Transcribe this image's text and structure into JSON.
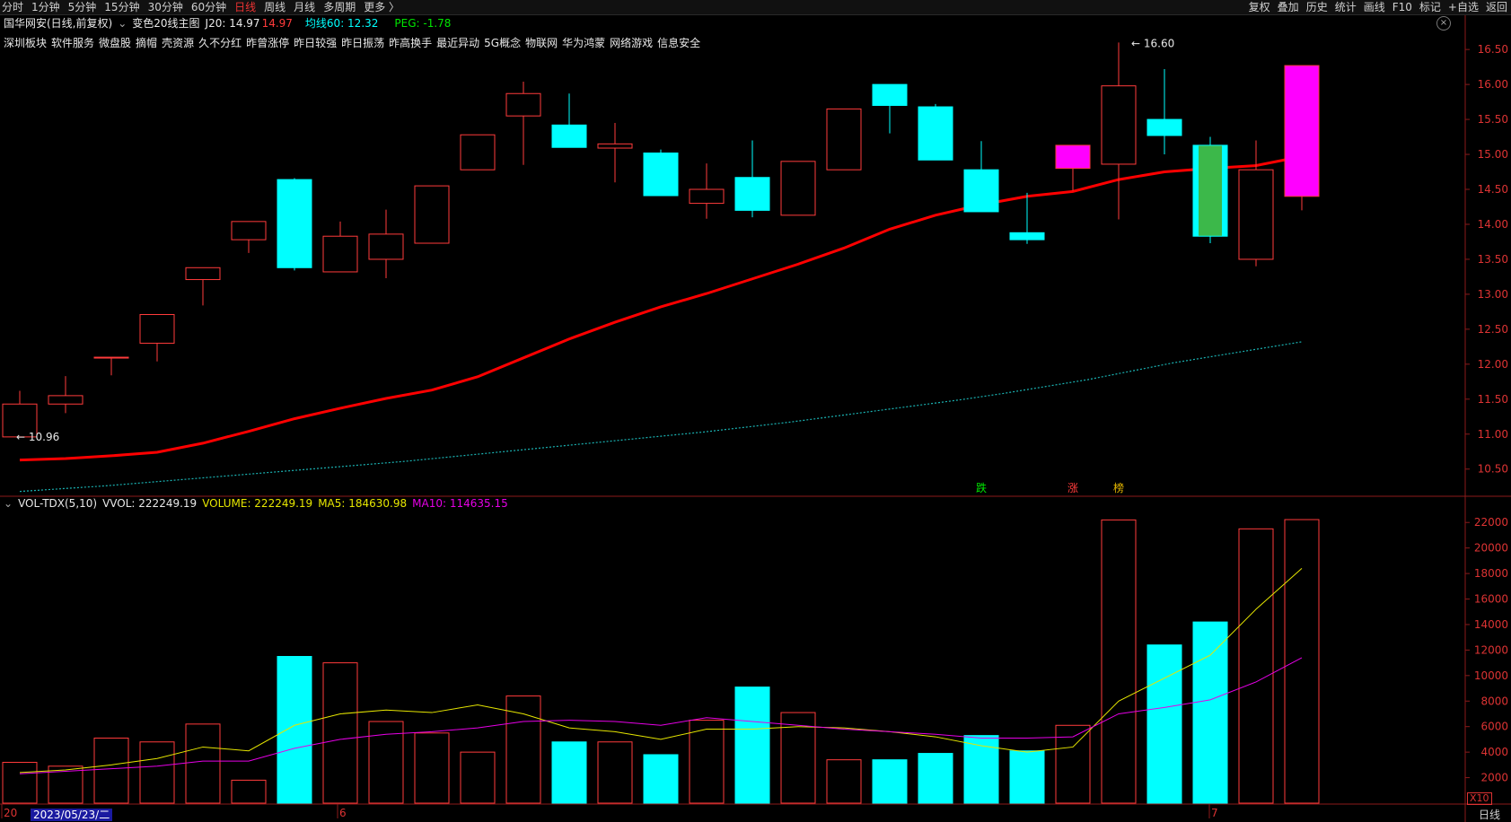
{
  "toolbar": {
    "periods": [
      "分时",
      "1分钟",
      "5分钟",
      "15分钟",
      "30分钟",
      "60分钟",
      "日线",
      "周线",
      "月线",
      "多周期",
      "更多 〉"
    ],
    "active_period": "日线",
    "right_buttons": [
      "复权",
      "叠加",
      "历史",
      "统计",
      "画线",
      "F10",
      "标记",
      "+自选",
      "返回"
    ]
  },
  "info": {
    "stock": "国华网安(日线,前复权)",
    "indicator": "变色20线主图",
    "j20_label": "J20: 14.97",
    "j20_extra": "14.97",
    "ma60_label": "均线60: 12.32",
    "peg_label": "PEG: -1.78"
  },
  "tags": [
    "深圳板块",
    "软件服务",
    "微盘股",
    "摘帽",
    "壳资源",
    "久不分红",
    "昨曾涨停",
    "昨日较强",
    "昨日振荡",
    "昨高换手",
    "最近异动",
    "5G概念",
    "物联网",
    "华为鸿蒙",
    "网络游戏",
    "信息安全"
  ],
  "volume_header": {
    "name": "VOL-TDX(5,10)",
    "vvol": "VVOL: 222249.19",
    "volume": "VOLUME: 222249.19",
    "ma5": "MA5: 184630.98",
    "ma10": "MA10: 114635.15"
  },
  "price_axis": [
    "16.50",
    "16.00",
    "15.50",
    "15.00",
    "14.50",
    "14.00",
    "13.50",
    "13.00",
    "12.50",
    "12.00",
    "11.50",
    "11.00",
    "10.50"
  ],
  "volume_axis": [
    "22000",
    "20000",
    "18000",
    "16000",
    "14000",
    "12000",
    "10000",
    "8000",
    "6000",
    "4000",
    "2000"
  ],
  "volume_unit": "X10",
  "markers": {
    "high": "16.60",
    "low": "10.96",
    "die": "跌",
    "zhang": "涨",
    "bang": "榜"
  },
  "x_labels": {
    "first": "20",
    "date": "2023/05/23/二",
    "june": "6",
    "july": "7"
  },
  "bottom_tab": "日线",
  "colors": {
    "up": "#ff3b3b",
    "down": "#00ffff",
    "ma_red": "#ff0000",
    "ma60": "#1ab2b2",
    "ma5": "#e6e600",
    "ma10": "#e600e6",
    "magenta": "#ff00ff",
    "green": "#3cb84a"
  },
  "chart_data": {
    "type": "candlestick",
    "candles": [
      {
        "o": 10.96,
        "h": 11.62,
        "l": 10.96,
        "c": 11.43,
        "color": "up"
      },
      {
        "o": 11.43,
        "h": 11.83,
        "l": 11.3,
        "c": 11.55,
        "color": "up"
      },
      {
        "o": 12.1,
        "h": 12.1,
        "l": 11.84,
        "c": 12.1,
        "color": "up"
      },
      {
        "o": 12.3,
        "h": 12.71,
        "l": 12.04,
        "c": 12.71,
        "color": "up"
      },
      {
        "o": 13.21,
        "h": 13.38,
        "l": 12.84,
        "c": 13.38,
        "color": "up"
      },
      {
        "o": 13.78,
        "h": 14.04,
        "l": 13.59,
        "c": 14.04,
        "color": "up"
      },
      {
        "o": 14.64,
        "h": 14.66,
        "l": 13.34,
        "c": 13.38,
        "color": "down"
      },
      {
        "o": 13.32,
        "h": 14.04,
        "l": 13.32,
        "c": 13.83,
        "color": "up"
      },
      {
        "o": 13.5,
        "h": 14.21,
        "l": 13.23,
        "c": 13.86,
        "color": "up"
      },
      {
        "o": 13.73,
        "h": 14.55,
        "l": 13.73,
        "c": 14.55,
        "color": "up"
      },
      {
        "o": 14.78,
        "h": 15.28,
        "l": 14.78,
        "c": 15.28,
        "color": "up"
      },
      {
        "o": 15.55,
        "h": 16.04,
        "l": 14.85,
        "c": 15.87,
        "color": "up"
      },
      {
        "o": 15.42,
        "h": 15.87,
        "l": 15.1,
        "c": 15.1,
        "color": "down"
      },
      {
        "o": 15.09,
        "h": 15.45,
        "l": 14.6,
        "c": 15.15,
        "color": "up"
      },
      {
        "o": 15.02,
        "h": 15.07,
        "l": 14.41,
        "c": 14.41,
        "color": "down"
      },
      {
        "o": 14.3,
        "h": 14.87,
        "l": 14.08,
        "c": 14.5,
        "color": "up"
      },
      {
        "o": 14.67,
        "h": 15.2,
        "l": 14.1,
        "c": 14.2,
        "color": "down"
      },
      {
        "o": 14.13,
        "h": 14.9,
        "l": 14.13,
        "c": 14.9,
        "color": "up"
      },
      {
        "o": 14.78,
        "h": 15.65,
        "l": 14.78,
        "c": 15.65,
        "color": "up"
      },
      {
        "o": 16.0,
        "h": 16.0,
        "l": 15.3,
        "c": 15.7,
        "color": "down"
      },
      {
        "o": 15.68,
        "h": 15.72,
        "l": 14.92,
        "c": 14.92,
        "color": "down"
      },
      {
        "o": 14.78,
        "h": 15.19,
        "l": 14.2,
        "c": 14.18,
        "color": "down"
      },
      {
        "o": 13.88,
        "h": 14.45,
        "l": 13.72,
        "c": 13.78,
        "color": "down"
      },
      {
        "o": 14.8,
        "h": 15.13,
        "l": 14.48,
        "c": 15.13,
        "color": "magenta"
      },
      {
        "o": 14.86,
        "h": 16.6,
        "l": 14.07,
        "c": 15.98,
        "color": "up"
      },
      {
        "o": 15.5,
        "h": 16.22,
        "l": 15.0,
        "c": 15.27,
        "color": "down"
      },
      {
        "o": 15.13,
        "h": 15.25,
        "l": 13.73,
        "c": 13.83,
        "color": "greencyan"
      },
      {
        "o": 13.5,
        "h": 15.2,
        "l": 13.4,
        "c": 14.78,
        "color": "up"
      },
      {
        "o": 14.4,
        "h": 16.27,
        "l": 14.2,
        "c": 16.27,
        "color": "magenta"
      }
    ],
    "ma20": [
      10.63,
      10.65,
      10.69,
      10.74,
      10.87,
      11.04,
      11.22,
      11.37,
      11.51,
      11.63,
      11.82,
      12.09,
      12.36,
      12.6,
      12.82,
      13.01,
      13.22,
      13.43,
      13.66,
      13.93,
      14.13,
      14.28,
      14.4,
      14.47,
      14.64,
      14.75,
      14.8,
      14.84,
      14.97
    ],
    "ma60": [
      10.18,
      10.22,
      10.26,
      10.31,
      10.36,
      10.41,
      10.46,
      10.51,
      10.56,
      10.61,
      10.67,
      10.73,
      10.79,
      10.85,
      10.91,
      10.97,
      11.03,
      11.1,
      11.17,
      11.25,
      11.33,
      11.41,
      11.49,
      11.58,
      11.68,
      11.78,
      11.9,
      12.02,
      12.12,
      12.22,
      12.32
    ],
    "volume": [
      {
        "v": 3200,
        "color": "up"
      },
      {
        "v": 2900,
        "color": "up"
      },
      {
        "v": 5100,
        "color": "up"
      },
      {
        "v": 4800,
        "color": "up"
      },
      {
        "v": 6200,
        "color": "up"
      },
      {
        "v": 1800,
        "color": "up"
      },
      {
        "v": 11500,
        "color": "down"
      },
      {
        "v": 11000,
        "color": "up"
      },
      {
        "v": 6400,
        "color": "up"
      },
      {
        "v": 5500,
        "color": "up"
      },
      {
        "v": 4000,
        "color": "up"
      },
      {
        "v": 8400,
        "color": "up"
      },
      {
        "v": 4800,
        "color": "down"
      },
      {
        "v": 4800,
        "color": "up"
      },
      {
        "v": 3800,
        "color": "down"
      },
      {
        "v": 6500,
        "color": "up"
      },
      {
        "v": 9100,
        "color": "down"
      },
      {
        "v": 7100,
        "color": "up"
      },
      {
        "v": 3400,
        "color": "up"
      },
      {
        "v": 3400,
        "color": "down"
      },
      {
        "v": 3900,
        "color": "down"
      },
      {
        "v": 5300,
        "color": "down"
      },
      {
        "v": 4100,
        "color": "down"
      },
      {
        "v": 6100,
        "color": "up"
      },
      {
        "v": 22200,
        "color": "up"
      },
      {
        "v": 12400,
        "color": "down"
      },
      {
        "v": 14200,
        "color": "down"
      },
      {
        "v": 21500,
        "color": "up"
      },
      {
        "v": 22225,
        "color": "up"
      }
    ],
    "vma5": [
      2400,
      2600,
      3000,
      3500,
      4400,
      4100,
      6100,
      7000,
      7300,
      7100,
      7700,
      7000,
      5900,
      5600,
      5000,
      5800,
      5800,
      6000,
      5900,
      5600,
      5200,
      4500,
      4000,
      4400,
      8000,
      9800,
      11600,
      15200,
      18400
    ],
    "vma10": [
      2300,
      2500,
      2700,
      2900,
      3300,
      3300,
      4300,
      5000,
      5400,
      5600,
      5900,
      6400,
      6500,
      6400,
      6100,
      6700,
      6400,
      6100,
      5800,
      5600,
      5400,
      5100,
      5100,
      5200,
      7000,
      7500,
      8100,
      9500,
      11400
    ]
  }
}
